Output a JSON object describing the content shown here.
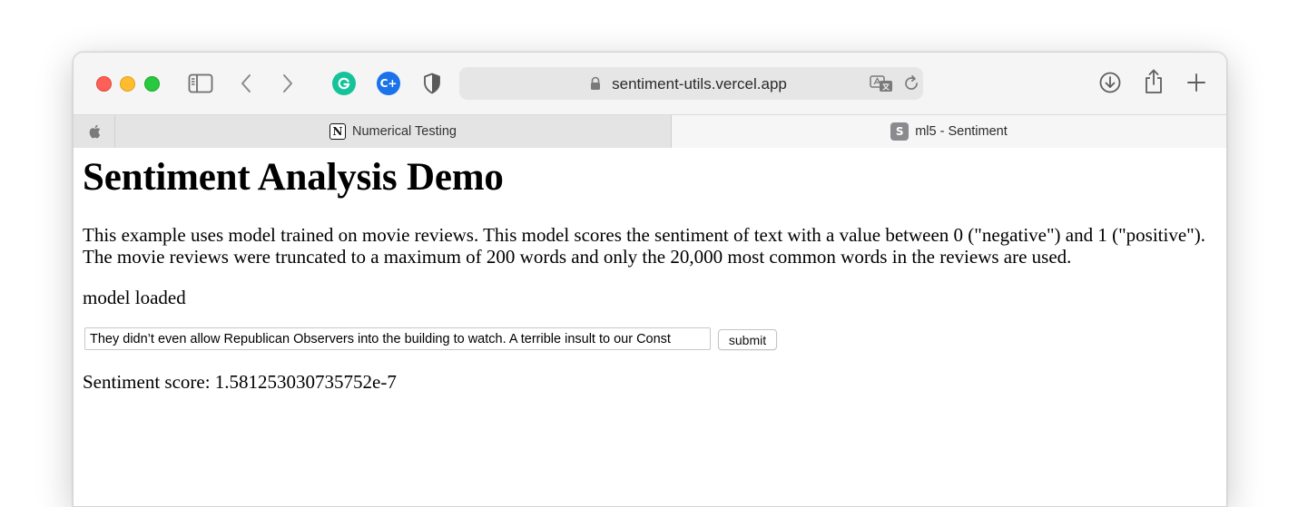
{
  "browser": {
    "url": "sentiment-utils.vercel.app",
    "tabs": [
      {
        "label": "Numerical Testing",
        "favicon": "notion-icon",
        "favicon_text": "N",
        "active": false
      },
      {
        "label": "ml5 - Sentiment",
        "favicon": "s-letter-icon",
        "favicon_text": "S",
        "active": true
      }
    ],
    "extensions": {
      "cplus_label": "C+"
    }
  },
  "page": {
    "title": "Sentiment Analysis Demo",
    "description": "This example uses model trained on movie reviews. This model scores the sentiment of text with a value between 0 (\"negative\") and 1 (\"positive\"). The movie reviews were truncated to a maximum of 200 words and only the 20,000 most common words in the reviews are used.",
    "status": "model loaded",
    "input_value": "They didn’t even allow Republican Observers into the building to watch. A terrible insult to our Const",
    "submit_label": "submit",
    "score_text": "Sentiment score: 1.581253030735752e-7"
  },
  "colors": {
    "close": "#fe5f57",
    "minimize": "#febc2e",
    "zoom": "#28c840",
    "grammarly": "#15c39a",
    "cplus": "#1a73e8"
  }
}
